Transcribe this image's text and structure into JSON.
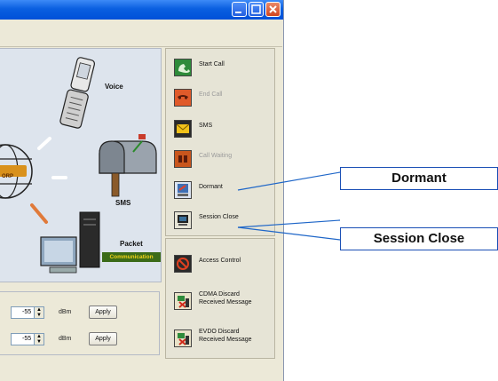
{
  "window": {
    "controls": [
      "minimize",
      "maximize",
      "close"
    ]
  },
  "diagram": {
    "labels": {
      "voice": "Voice",
      "sms": "SMS",
      "packet": "Packet",
      "packet_comm": "Communication",
      "orp": "ORP"
    }
  },
  "controls": [
    {
      "label": "Start Call",
      "enabled": true,
      "color": "#2e8b3a",
      "icon": "phone-icon"
    },
    {
      "label": "End Call",
      "enabled": false,
      "color": "#e05a2a",
      "icon": "hangup-icon"
    },
    {
      "label": "SMS",
      "enabled": true,
      "color": "#f2c21a",
      "icon": "envelope-icon"
    },
    {
      "label": "Call Waiting",
      "enabled": false,
      "color": "#c9561d",
      "icon": "hold-icon"
    },
    {
      "label": "Dormant",
      "enabled": true,
      "color": "#3e6fb4",
      "icon": "dormant-icon"
    },
    {
      "label": "Session Close",
      "enabled": true,
      "color": "#3a6f9a",
      "icon": "monitor-icon"
    }
  ],
  "controls2": [
    {
      "label": "Access Control",
      "line1": "Access Control",
      "line2": "",
      "icon": "access-control-icon"
    },
    {
      "label": "CDMA Discard Received Message",
      "line1": "CDMA Discard",
      "line2": "Received Message",
      "icon": "discard-icon"
    },
    {
      "label": "EVDO Discard Received Message",
      "line1": "EVDO Discard",
      "line2": "Received Message",
      "icon": "discard-icon"
    }
  ],
  "power_rows": [
    {
      "value": "-55",
      "unit": "dBm",
      "apply": "Apply"
    },
    {
      "value": "-55",
      "unit": "dBm",
      "apply": "Apply"
    }
  ],
  "callouts": {
    "dormant": "Dormant",
    "session_close": "Session Close"
  },
  "colors": {
    "title_bar": "#0a5fe0",
    "callout_border": "#1a4fb5",
    "callout_line": "#1e66c8"
  }
}
